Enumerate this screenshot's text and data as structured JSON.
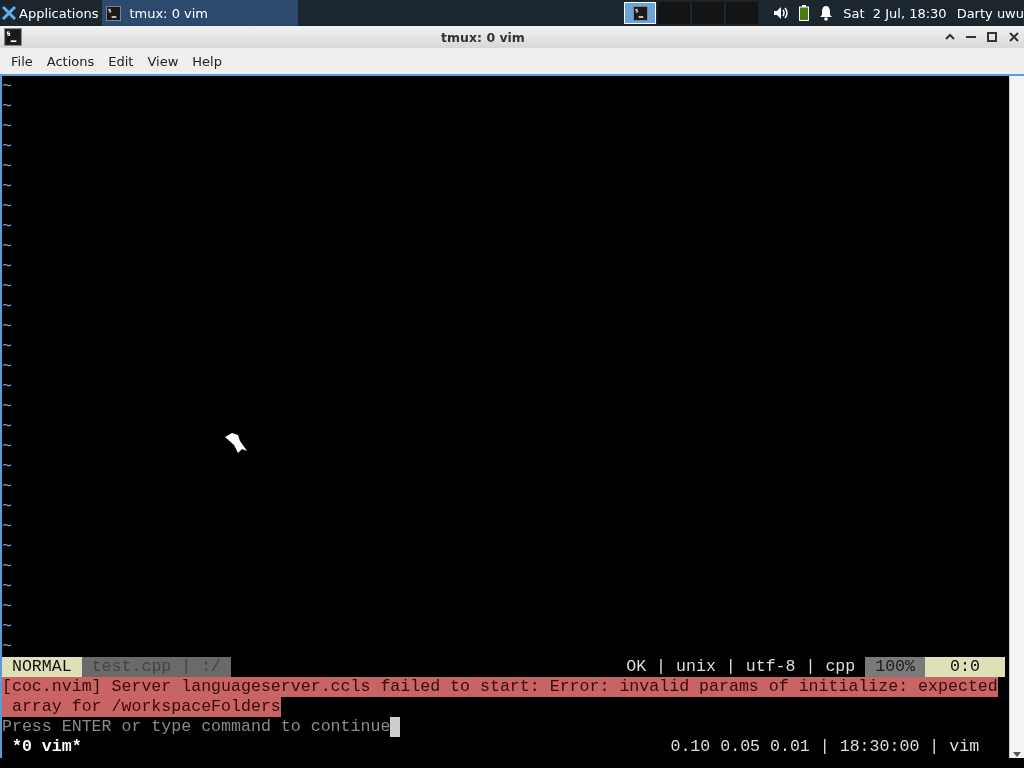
{
  "taskbar": {
    "apps_label": "Applications",
    "tasks": [
      {
        "label": "tmux: 0 vim",
        "selected": true
      }
    ],
    "workspaces": [
      {
        "selected": true
      },
      {
        "selected": false
      },
      {
        "selected": false
      },
      {
        "selected": false
      }
    ],
    "clock": "Sat  2 Jul, 18:30",
    "user": "Darty uwu"
  },
  "window": {
    "title": "tmux: 0 vim",
    "menu": [
      "File",
      "Actions",
      "Edit",
      "View",
      "Help"
    ]
  },
  "terminal": {
    "tildes": [
      "~",
      "~",
      "~",
      "~",
      "~",
      "~",
      "~",
      "~",
      "~",
      "~",
      "~",
      "~",
      "~",
      "~",
      "~",
      "~",
      "~",
      "~",
      "~",
      "~",
      "~",
      "~",
      "~",
      "~",
      "~",
      "~",
      "~",
      "~",
      "~"
    ],
    "statusline": {
      "mode": "NORMAL",
      "file_info": "test.cpp | :/",
      "file_info_right": "OK | unix | utf-8 | cpp",
      "percent": "100%",
      "position": "0:0"
    },
    "message_lines": [
      "[coc.nvim] Server languageserver.ccls failed to start: Error: invalid params of initialize: expected",
      " array for /workspaceFolders"
    ],
    "prompt": "Press ENTER or type command to continue",
    "tmux": {
      "window": "*0 vim*",
      "status": "0.10 0.05 0.01 | 18:30:00 | vim"
    }
  }
}
